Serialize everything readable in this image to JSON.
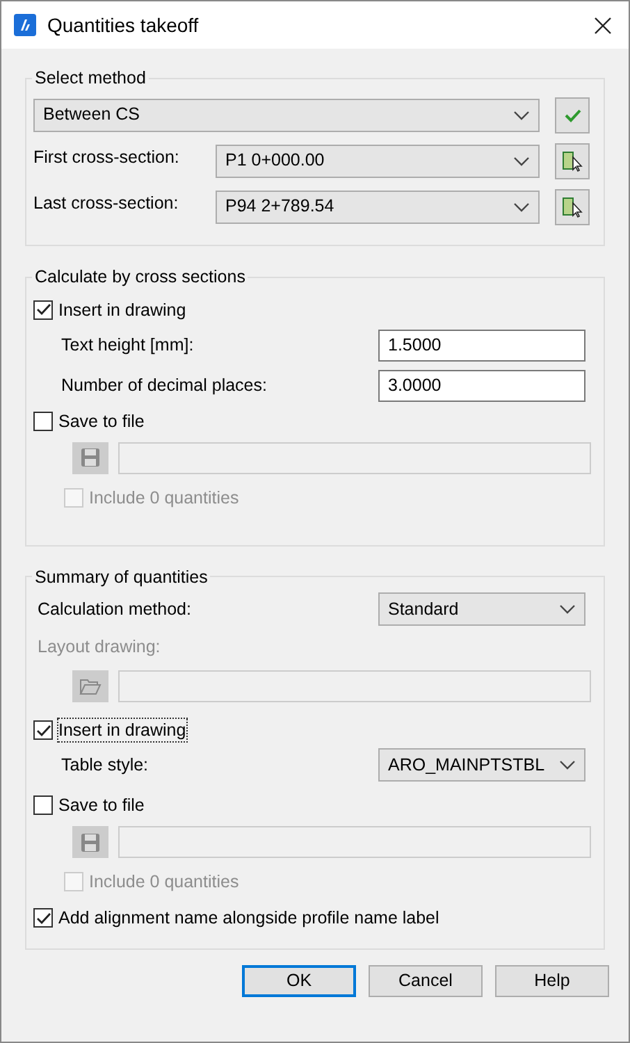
{
  "window": {
    "title": "Quantities takeoff"
  },
  "select_method": {
    "title": "Select method",
    "method": {
      "value": "Between CS"
    },
    "rows": [
      {
        "label": "First cross-section:",
        "value": "P1 0+000.00"
      },
      {
        "label": "Last cross-section:",
        "value": "P94 2+789.54"
      }
    ]
  },
  "cross_sections": {
    "title": "Calculate by cross sections",
    "insert_in_drawing": {
      "label": "Insert in drawing",
      "checked": true
    },
    "fields": [
      {
        "label": "Text height [mm]:",
        "value": "1.5000"
      },
      {
        "label": "Number of decimal places:",
        "value": "3.0000"
      }
    ],
    "save_to_file": {
      "label": "Save to file",
      "checked": false
    },
    "include_zero": {
      "label": "Include 0 quantities",
      "checked": false,
      "disabled": true
    }
  },
  "summary": {
    "title": "Summary of quantities",
    "calculation_method": {
      "label": "Calculation method:",
      "value": "Standard"
    },
    "layout_drawing": {
      "label": "Layout drawing:",
      "disabled": true
    },
    "insert_in_drawing": {
      "label": "Insert in drawing",
      "checked": true,
      "focused": true
    },
    "table_style": {
      "label": "Table style:",
      "value": "ARO_MAINPTSTBL"
    },
    "save_to_file": {
      "label": "Save to file",
      "checked": false
    },
    "include_zero": {
      "label": "Include 0 quantities",
      "checked": false,
      "disabled": true
    },
    "add_alignment_name": {
      "label": "Add alignment name alongside profile name label",
      "checked": true
    }
  },
  "buttons": [
    {
      "label": "OK",
      "default": true
    },
    {
      "label": "Cancel",
      "default": false
    },
    {
      "label": "Help",
      "default": false
    }
  ]
}
